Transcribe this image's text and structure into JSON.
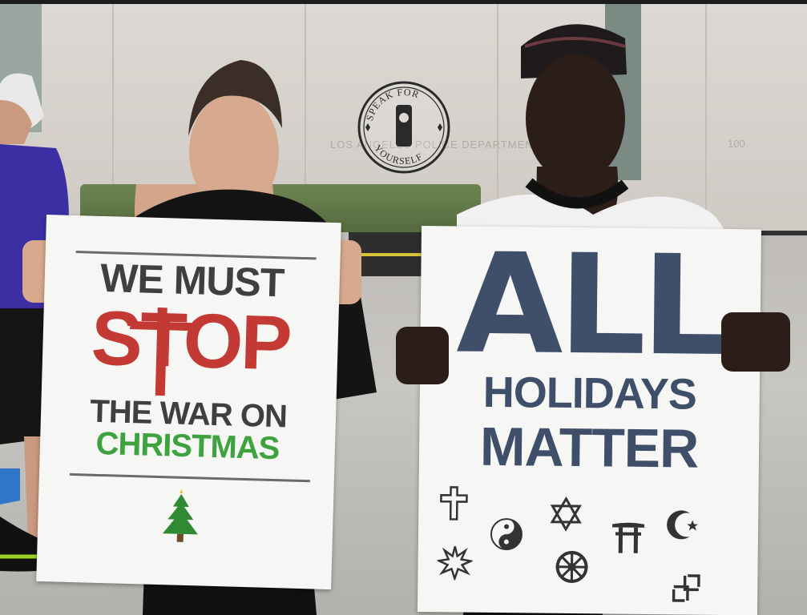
{
  "background": {
    "building_text": "LOS ANGELES POLICE DEPARTMENT",
    "building_number": "100"
  },
  "logo": {
    "text": "SPEAK FOR YOURSELF"
  },
  "sign_left": {
    "line1": "WE MUST",
    "line2": "STOP",
    "line3": "THE WAR ON",
    "line4": "CHRISTMAS",
    "colors": {
      "dark": "#3f3f3f",
      "red": "#c33a34",
      "green": "#3ea33e"
    },
    "icon": "christmas-tree-icon"
  },
  "sign_right": {
    "line1": "ALL",
    "line2": "HOLIDAYS",
    "line3": "MATTER",
    "color": "#3f4f6a",
    "symbols": [
      "cross-icon",
      "star-of-david-icon",
      "torii-gate-icon",
      "crescent-star-icon",
      "yin-yang-icon",
      "nine-point-star-icon",
      "dharma-wheel-icon",
      "swastika-icon"
    ]
  }
}
